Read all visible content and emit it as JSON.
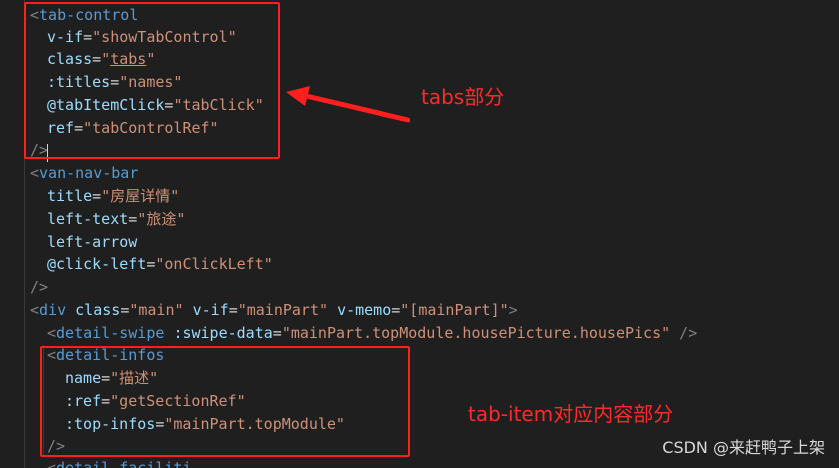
{
  "colors": {
    "background": "#1f1f1f",
    "punctuation": "#808080",
    "tag": "#569cd6",
    "attribute": "#9cdcfe",
    "string": "#ce9178",
    "annotation_red": "#ff2a2a",
    "guide": "#3a3a3a"
  },
  "code": {
    "lines": [
      {
        "tokens": [
          {
            "t": "<",
            "k": "punct"
          },
          {
            "t": "tab-control",
            "k": "tag"
          }
        ]
      },
      {
        "tokens": [
          {
            "t": "v-if",
            "k": "attr"
          },
          {
            "t": "=",
            "k": "eq"
          },
          {
            "t": "\"showTabControl\"",
            "k": "str"
          }
        ]
      },
      {
        "tokens": [
          {
            "t": "class",
            "k": "attr"
          },
          {
            "t": "=",
            "k": "eq"
          },
          {
            "t": "\"",
            "k": "str"
          },
          {
            "t": "tabs",
            "k": "str-underline"
          },
          {
            "t": "\"",
            "k": "str"
          }
        ]
      },
      {
        "tokens": [
          {
            "t": ":titles",
            "k": "attr"
          },
          {
            "t": "=",
            "k": "eq"
          },
          {
            "t": "\"names\"",
            "k": "str"
          }
        ]
      },
      {
        "tokens": [
          {
            "t": "@tabItemClick",
            "k": "attr"
          },
          {
            "t": "=",
            "k": "eq"
          },
          {
            "t": "\"tabClick\"",
            "k": "str"
          }
        ]
      },
      {
        "tokens": [
          {
            "t": "ref",
            "k": "attr"
          },
          {
            "t": "=",
            "k": "eq"
          },
          {
            "t": "\"tabControlRef\"",
            "k": "str"
          }
        ]
      },
      {
        "tokens": [
          {
            "t": "/>",
            "k": "punct"
          }
        ]
      },
      {
        "tokens": [
          {
            "t": "<",
            "k": "punct"
          },
          {
            "t": "van-nav-bar",
            "k": "tag"
          }
        ]
      },
      {
        "tokens": [
          {
            "t": "title",
            "k": "attr"
          },
          {
            "t": "=",
            "k": "eq"
          },
          {
            "t": "\"房屋详情\"",
            "k": "str"
          }
        ]
      },
      {
        "tokens": [
          {
            "t": "left-text",
            "k": "attr"
          },
          {
            "t": "=",
            "k": "eq"
          },
          {
            "t": "\"旅途\"",
            "k": "str"
          }
        ]
      },
      {
        "tokens": [
          {
            "t": "left-arrow",
            "k": "attr"
          }
        ]
      },
      {
        "tokens": [
          {
            "t": "@click-left",
            "k": "attr"
          },
          {
            "t": "=",
            "k": "eq"
          },
          {
            "t": "\"onClickLeft\"",
            "k": "str"
          }
        ]
      },
      {
        "tokens": [
          {
            "t": "/>",
            "k": "punct"
          }
        ]
      },
      {
        "tokens": [
          {
            "t": "<",
            "k": "punct"
          },
          {
            "t": "div",
            "k": "tag"
          },
          {
            "t": " ",
            "k": "plain"
          },
          {
            "t": "class",
            "k": "attr"
          },
          {
            "t": "=",
            "k": "eq"
          },
          {
            "t": "\"main\"",
            "k": "str"
          },
          {
            "t": " ",
            "k": "plain"
          },
          {
            "t": "v-if",
            "k": "attr"
          },
          {
            "t": "=",
            "k": "eq"
          },
          {
            "t": "\"mainPart\"",
            "k": "str"
          },
          {
            "t": " ",
            "k": "plain"
          },
          {
            "t": "v-memo",
            "k": "attr"
          },
          {
            "t": "=",
            "k": "eq"
          },
          {
            "t": "\"[mainPart]\"",
            "k": "str"
          },
          {
            "t": ">",
            "k": "punct"
          }
        ]
      },
      {
        "tokens": [
          {
            "t": "<",
            "k": "punct"
          },
          {
            "t": "detail-swipe",
            "k": "tag"
          },
          {
            "t": " ",
            "k": "plain"
          },
          {
            "t": ":swipe-data",
            "k": "attr"
          },
          {
            "t": "=",
            "k": "eq"
          },
          {
            "t": "\"mainPart.topModule.housePicture.housePics\"",
            "k": "str"
          },
          {
            "t": " />",
            "k": "punct"
          }
        ]
      },
      {
        "tokens": [
          {
            "t": "<",
            "k": "punct"
          },
          {
            "t": "detail-infos",
            "k": "tag"
          }
        ]
      },
      {
        "tokens": [
          {
            "t": "name",
            "k": "attr"
          },
          {
            "t": "=",
            "k": "eq"
          },
          {
            "t": "\"描述\"",
            "k": "str"
          }
        ]
      },
      {
        "tokens": [
          {
            "t": ":ref",
            "k": "attr"
          },
          {
            "t": "=",
            "k": "eq"
          },
          {
            "t": "\"getSectionRef\"",
            "k": "str"
          }
        ]
      },
      {
        "tokens": [
          {
            "t": ":top-infos",
            "k": "attr"
          },
          {
            "t": "=",
            "k": "eq"
          },
          {
            "t": "\"mainPart.topModule\"",
            "k": "str"
          }
        ]
      },
      {
        "tokens": [
          {
            "t": "/>",
            "k": "punct"
          }
        ]
      },
      {
        "tokens": [
          {
            "t": "<",
            "k": "punct"
          },
          {
            "t": "detail-faciliti",
            "k": "tag"
          }
        ]
      }
    ]
  },
  "annotations": {
    "tabs_label": "tabs部分",
    "tab_item_label": "tab-item对应内容部分"
  },
  "watermark": "CSDN @来赶鸭子上架"
}
